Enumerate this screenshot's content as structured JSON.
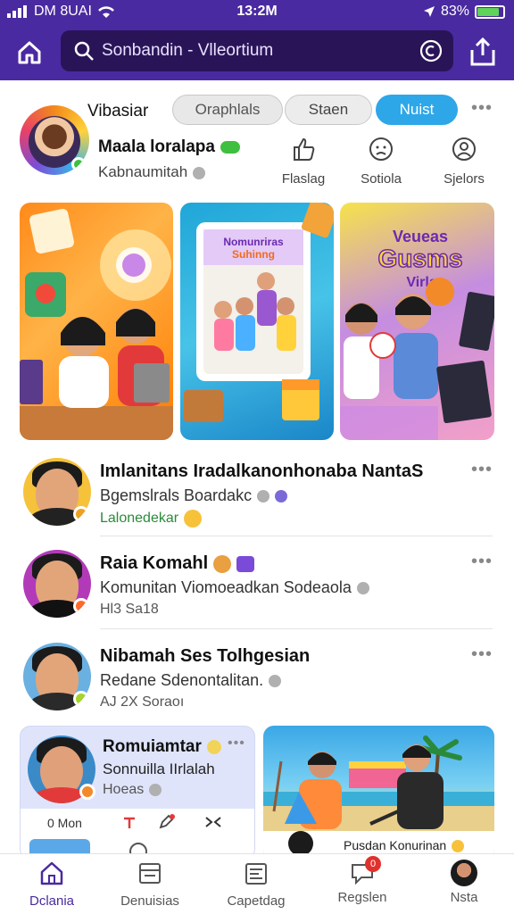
{
  "status_bar": {
    "carrier": "DM 8UAI",
    "time": "13:2M",
    "battery": "83%"
  },
  "header": {
    "search_text": "Sonbandin - Vlleortium",
    "search_icon": "search-icon",
    "share_icon": "share-icon"
  },
  "profile": {
    "title": "Vibasiar",
    "chips": [
      "Oraphlals",
      "Staen",
      "Nuist"
    ],
    "name": "Maala loralapa",
    "subtitle": "Kabnaumitah",
    "actions": [
      "Flaslag",
      "Sotiola",
      "Sjelors"
    ]
  },
  "cards": [
    {
      "label": ""
    },
    {
      "label": "Nomunriras Suhinng"
    },
    {
      "label": "Veueas Gusms Virlac"
    }
  ],
  "feed": [
    {
      "title": "Imlanitans Iradalkanonhonaba NantaS",
      "subtitle": "Bgemslrals Boardakc",
      "meta": "Lalonedekar",
      "meta_color": "#2a8a3a",
      "badge_color": "#f0a020"
    },
    {
      "title": "Raia Komahl",
      "subtitle": "Komunitan Viomoeadkan Sodeaola",
      "meta": "Hl3 Sa18",
      "meta_color": "#555555",
      "badge_color": "#ff6a2a"
    },
    {
      "title": "Nibamah Ses Tolhgesian",
      "subtitle": "Redane Sdenontalitan.",
      "meta": "AJ 2X Soraoı",
      "meta_color": "#555555",
      "badge_color": "#a6d42a"
    }
  ],
  "bottom_card_left": {
    "title": "Romuiamtar",
    "subtitle": "Sonnuilla IIrlalah",
    "meta": "Hoeas",
    "footer": [
      "0 Mon",
      "",
      "",
      ""
    ]
  },
  "bottom_card_right": {
    "caption": "Pusdan Konurinan"
  },
  "bottom_nav": [
    {
      "label": "Dclania",
      "icon": "home-icon",
      "active": true
    },
    {
      "label": "Denuisias",
      "icon": "inbox-icon",
      "active": false
    },
    {
      "label": "Capetdag",
      "icon": "calendar-icon",
      "active": false
    },
    {
      "label": "Regslen",
      "icon": "chat-icon",
      "active": false,
      "badge": "0"
    },
    {
      "label": "Nsta",
      "icon": "profile-icon",
      "active": false
    }
  ],
  "colors": {
    "brand": "#4a2aa0",
    "accent": "#2ea7e8",
    "online": "#3fbf3f"
  }
}
